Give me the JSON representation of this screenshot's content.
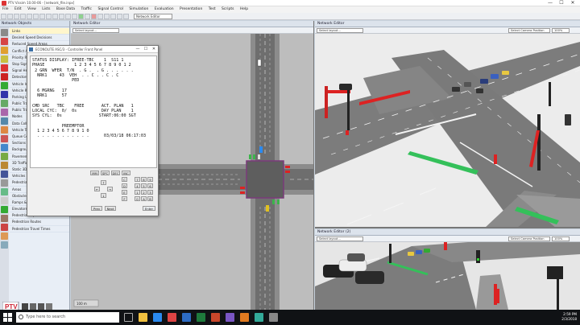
{
  "window": {
    "title": "PTV Vissim 10.00-06 - [network_file.inpx]",
    "controls": {
      "minimize": "—",
      "maximize": "☐",
      "close": "✕"
    }
  },
  "menu": [
    "File",
    "Edit",
    "View",
    "Lists",
    "Base Data",
    "Traffic",
    "Signal Control",
    "Simulation",
    "Evaluation",
    "Presentation",
    "Test",
    "Scripts",
    "Help"
  ],
  "toolbar": {
    "dropdown_label": "Network Editor"
  },
  "left_panel": {
    "title": "Network Objects",
    "items": [
      "Links",
      "Desired Speed Decisions",
      "Reduced Speed Areas",
      "Conflict Areas",
      "Priority Rules",
      "Stop Signs",
      "Signal Heads",
      "Detectors",
      "Vehicle Inputs",
      "Vehicle Routes",
      "Parking Lots",
      "Public Transport Stops",
      "Public Transport Lines",
      "Nodes",
      "Data Collection Points",
      "Vehicle Travel Times",
      "Queue Counters",
      "Sections",
      "Background Images",
      "Pavement Markings",
      "3D Traffic Signals",
      "Static 3D Models",
      "Vehicles In Network",
      "Pedestrians In Network",
      "Areas",
      "Obstacles",
      "Ramps & Stairs",
      "Elevators",
      "Pedestrian Inputs",
      "Pedestrian Routes",
      "Pedestrian Travel Times"
    ],
    "logo_text": "PTV"
  },
  "editor1": {
    "title": "Network Editor",
    "layout_dropdown": "Select layout...",
    "scale_label": "100 m"
  },
  "dialog": {
    "title": "ECONOLITE ASC/3 - Controller Front Panel",
    "screen_lines": [
      "STATUS DISPLAY: IFREE-TBC    1  S11 1",
      "PHASE            1 2 3 4 5 6 7 8 9 0 1 2",
      " 2 GRN  WFER  T/N  . G .  . G . . . . . .",
      "  NRK1     43  VEH  . . C . . C . C",
      "                PED",
      "",
      "  6 MGRNG   17",
      "  NRK1      57",
      "",
      "CMD SRC   TBC    FREE       ACT. PLAN   1",
      "LOCAL CYC:  0/  0s          DAY PLAN    1",
      "SYS CYL:  0s               START:06:00 SGT",
      "",
      "            PREEMPTOR",
      "  1 2 3 4 5 6 7 8 9 1 0",
      "  . . . . . . . . . . .      03/03/18 06:17:03"
    ],
    "keys": {
      "row1": [
        "MM",
        "SPC",
        "DEC",
        "INC"
      ],
      "row2": [
        "7",
        "8",
        "9",
        "C"
      ],
      "row3": [
        "4",
        "5",
        "6",
        "D"
      ],
      "row4": [
        "1",
        "2",
        "3",
        "E"
      ],
      "row5": [
        "0",
        "A",
        "B",
        "F"
      ],
      "nav": [
        "←",
        "→",
        "↑",
        "↓"
      ],
      "bottom": [
        "Prev",
        "Next",
        "Enter"
      ]
    }
  },
  "editor2": {
    "title": "Network Editor",
    "layout_dropdown": "Select layout...",
    "camera_dropdown": "Select Camera Position",
    "zoom": "100%"
  },
  "editor3": {
    "title": "Network Editor (2)",
    "layout_dropdown": "Select layout...",
    "camera_dropdown": "Select Camera Position",
    "zoom": "100%"
  },
  "taskbar": {
    "search_placeholder": "Type here to search",
    "time": "2:59 PM",
    "date": "2/3/2018"
  },
  "colors": {
    "road": "#6f6f6f",
    "lane_mark": "#ffffff",
    "detector_green": "#34c05a",
    "signal_red": "#d2262a",
    "ground_3d": "#ececec",
    "taskbar": "#101215"
  }
}
